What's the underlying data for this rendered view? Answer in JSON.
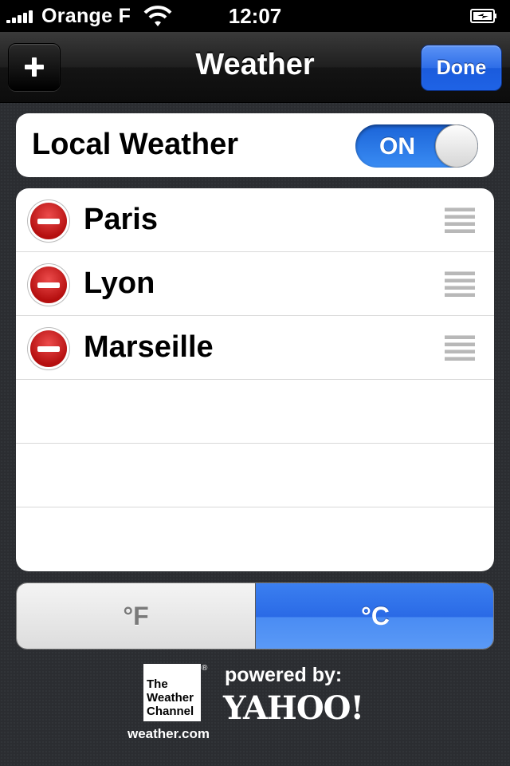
{
  "status_bar": {
    "carrier": "Orange F",
    "time": "12:07"
  },
  "nav": {
    "title": "Weather",
    "done_label": "Done"
  },
  "local_weather": {
    "label": "Local Weather",
    "toggle_label": "ON",
    "enabled": true
  },
  "cities": [
    {
      "name": "Paris"
    },
    {
      "name": "Lyon"
    },
    {
      "name": "Marseille"
    }
  ],
  "units": {
    "fahrenheit": "°F",
    "celsius": "°C",
    "selected": "°C"
  },
  "credits": {
    "twc_line1": "The",
    "twc_line2": "Weather",
    "twc_line3": "Channel",
    "twc_reg": "®",
    "weather_com": "weather.com",
    "powered_by": "powered by:",
    "yahoo": "YAHOO!"
  },
  "colors": {
    "accent_blue": "#2e6ee8",
    "delete_red": "#c21a1a",
    "background": "#2b2d31"
  }
}
